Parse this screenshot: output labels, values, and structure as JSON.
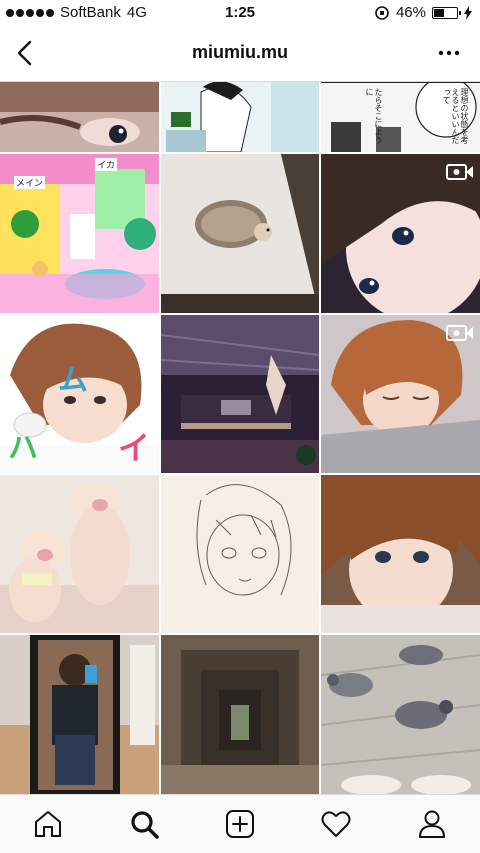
{
  "status_bar": {
    "carrier": "SoftBank",
    "network": "4G",
    "time": "1:25",
    "battery_percent": "46%",
    "battery_level": 0.46
  },
  "header": {
    "title": "miumiu.mu",
    "back_icon": "chevron-left-icon",
    "more_icon": "more-horizontal-icon"
  },
  "grid": {
    "manga_texts": {
      "tile3_bubble": "理想の状態を考えるといいんだって",
      "tile3_side": "たらそこにように",
      "tile4_sign1": "メイン",
      "tile4_sign2": "イカ"
    },
    "overlay_texts": {
      "kana_mu": "ム",
      "kana_i": "イ",
      "kana_ha": "ハ"
    },
    "video_badge_icon": "video-camera-icon"
  },
  "tabbar": {
    "tabs": [
      {
        "icon": "home-icon",
        "active": false
      },
      {
        "icon": "search-icon",
        "active": true
      },
      {
        "icon": "add-post-icon",
        "active": false
      },
      {
        "icon": "heart-icon",
        "active": false
      },
      {
        "icon": "profile-icon",
        "active": false
      }
    ]
  }
}
